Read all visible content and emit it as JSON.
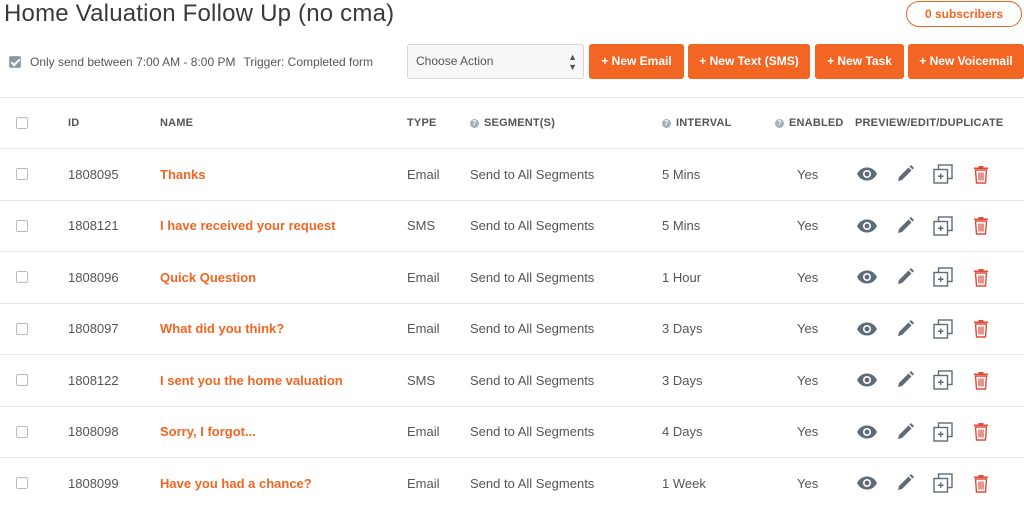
{
  "page": {
    "title": "Home Valuation Follow Up (no cma)"
  },
  "subscribers": {
    "label": "0 subscribers"
  },
  "settings": {
    "send_window": "Only send between 7:00 AM - 8:00 PM",
    "trigger": "Trigger: Completed form"
  },
  "toolbar": {
    "action_select": "Choose Action",
    "new_email": "+ New Email",
    "new_text": "+ New Text (SMS)",
    "new_task": "+ New Task",
    "new_voicemail": "+ New Voicemail"
  },
  "table": {
    "headers": {
      "id": "ID",
      "name": "NAME",
      "type": "TYPE",
      "segments": "SEGMENT(S)",
      "interval": "INTERVAL",
      "enabled": "ENABLED",
      "actions": "PREVIEW/EDIT/DUPLICATE"
    },
    "rows": [
      {
        "id": "1808095",
        "name": "Thanks",
        "type": "Email",
        "segment": "Send to All Segments",
        "interval": "5 Mins",
        "enabled": "Yes"
      },
      {
        "id": "1808121",
        "name": "I have received your request",
        "type": "SMS",
        "segment": "Send to All Segments",
        "interval": "5 Mins",
        "enabled": "Yes"
      },
      {
        "id": "1808096",
        "name": "Quick Question",
        "type": "Email",
        "segment": "Send to All Segments",
        "interval": "1 Hour",
        "enabled": "Yes"
      },
      {
        "id": "1808097",
        "name": "What did you think?",
        "type": "Email",
        "segment": "Send to All Segments",
        "interval": "3 Days",
        "enabled": "Yes"
      },
      {
        "id": "1808122",
        "name": "I sent you the home valuation",
        "type": "SMS",
        "segment": "Send to All Segments",
        "interval": "3 Days",
        "enabled": "Yes"
      },
      {
        "id": "1808098",
        "name": "Sorry, I forgot...",
        "type": "Email",
        "segment": "Send to All Segments",
        "interval": "4 Days",
        "enabled": "Yes"
      },
      {
        "id": "1808099",
        "name": "Have you had a chance?",
        "type": "Email",
        "segment": "Send to All Segments",
        "interval": "1 Week",
        "enabled": "Yes"
      }
    ]
  },
  "icons": {
    "preview": "eye-icon",
    "edit": "pencil-icon",
    "duplicate": "duplicate-icon",
    "delete": "trash-icon"
  },
  "colors": {
    "accent": "#f26522",
    "icon_gray": "#5f6b78",
    "delete_red": "#e04b3a"
  }
}
